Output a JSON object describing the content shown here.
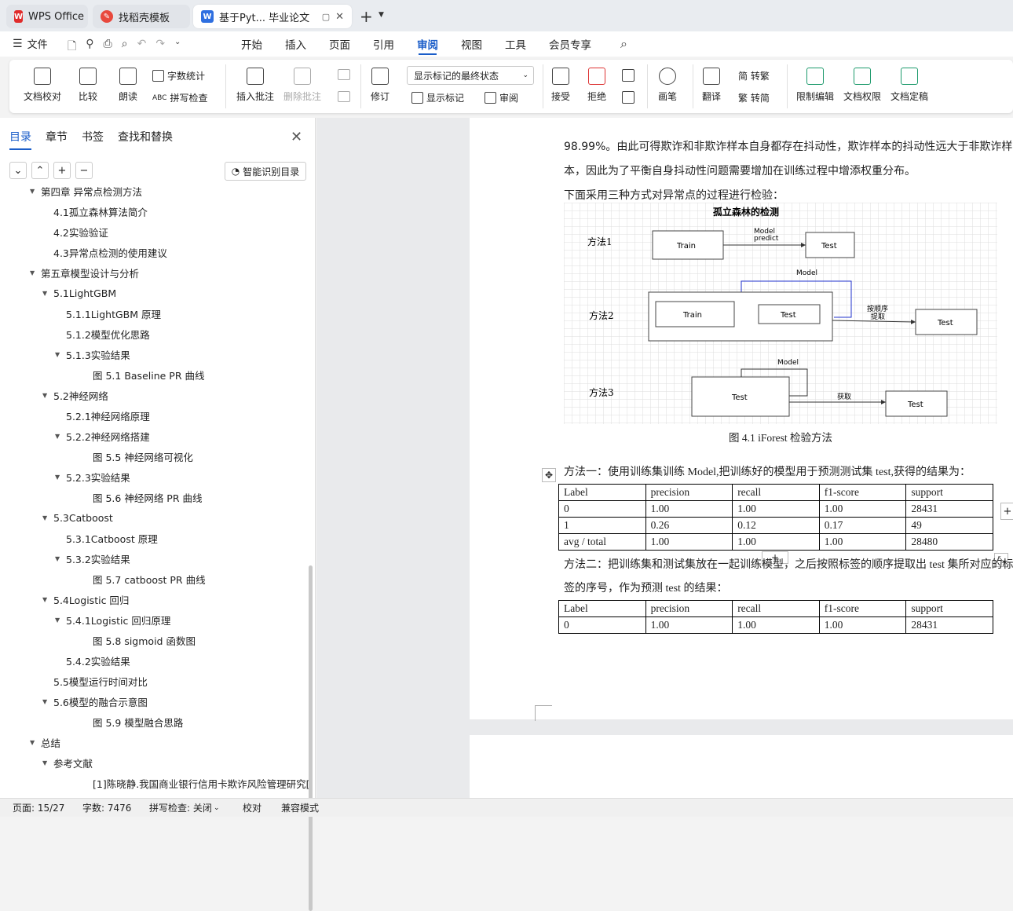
{
  "tabs": [
    {
      "label": "WPS Office",
      "icon": "wps-logo-icon"
    },
    {
      "label": "找稻壳模板",
      "icon": "docer-logo-icon"
    },
    {
      "label": "基于Pyt... 毕业论文",
      "icon": "word-doc-icon"
    }
  ],
  "menu": {
    "file": "文件",
    "items": [
      "开始",
      "插入",
      "页面",
      "引用",
      "审阅",
      "视图",
      "工具",
      "会员专享"
    ],
    "active": "审阅"
  },
  "ribbon": {
    "doc_check": "文档校对",
    "compare": "比较",
    "read_aloud": "朗读",
    "word_count": "字数统计",
    "spell_check": "拼写检查",
    "insert_comment": "插入批注",
    "delete_comment": "删除批注",
    "revise": "修订",
    "markup_state": "显示标记的最终状态",
    "show_markup": "显示标记",
    "review_pane": "审阅",
    "accept": "接受",
    "reject": "拒绝",
    "pen": "画笔",
    "translate": "翻译",
    "to_traditional": "简 转繁",
    "to_simplified": "繁 转简",
    "restrict_edit": "限制编辑",
    "doc_permission": "文档权限",
    "doc_finalize": "文档定稿"
  },
  "left_panel": {
    "tabs": [
      "目录",
      "章节",
      "书签",
      "查找和替换"
    ],
    "smart_btn": "智能识别目录",
    "toc": [
      {
        "label": "第四章 异常点检测方法",
        "level": 1,
        "expand": "down"
      },
      {
        "label": "4.1孤立森林算法简介",
        "level": 2,
        "expand": ""
      },
      {
        "label": "4.2实验验证",
        "level": 2,
        "expand": ""
      },
      {
        "label": "4.3异常点检测的使用建议",
        "level": 2,
        "expand": ""
      },
      {
        "label": "第五章模型设计与分析",
        "level": 1,
        "expand": "down"
      },
      {
        "label": "5.1LightGBM",
        "level": 2,
        "expand": "down"
      },
      {
        "label": "5.1.1LightGBM 原理",
        "level": 3,
        "expand": ""
      },
      {
        "label": "5.1.2模型优化思路",
        "level": 3,
        "expand": ""
      },
      {
        "label": "5.1.3实验结果",
        "level": 3,
        "expand": "down"
      },
      {
        "label": "图 5.1 Baseline PR 曲线",
        "level": 4,
        "expand": ""
      },
      {
        "label": "5.2神经网络",
        "level": 2,
        "expand": "down"
      },
      {
        "label": "5.2.1神经网络原理",
        "level": 3,
        "expand": ""
      },
      {
        "label": "5.2.2神经网络搭建",
        "level": 3,
        "expand": "down"
      },
      {
        "label": "图 5.5 神经网络可视化",
        "level": 4,
        "expand": ""
      },
      {
        "label": "5.2.3实验结果",
        "level": 3,
        "expand": "down"
      },
      {
        "label": "图 5.6  神经网络 PR 曲线",
        "level": 4,
        "expand": ""
      },
      {
        "label": "5.3Catboost",
        "level": 2,
        "expand": "down"
      },
      {
        "label": "5.3.1Catboost 原理",
        "level": 3,
        "expand": ""
      },
      {
        "label": "5.3.2实验结果",
        "level": 3,
        "expand": "down"
      },
      {
        "label": "图 5.7 catboost PR 曲线",
        "level": 4,
        "expand": ""
      },
      {
        "label": "5.4Logistic 回归",
        "level": 2,
        "expand": "down"
      },
      {
        "label": "5.4.1Logistic 回归原理",
        "level": 3,
        "expand": "down"
      },
      {
        "label": "图 5.8  sigmoid 函数图",
        "level": 4,
        "expand": ""
      },
      {
        "label": "5.4.2实验结果",
        "level": 3,
        "expand": ""
      },
      {
        "label": "5.5模型运行时间对比",
        "level": 2,
        "expand": ""
      },
      {
        "label": "5.6模型的融合示意图",
        "level": 2,
        "expand": "down"
      },
      {
        "label": "图 5.9 模型融合思路",
        "level": 4,
        "expand": ""
      },
      {
        "label": "总结",
        "level": 1,
        "expand": "down"
      },
      {
        "label": "参考文献",
        "level": 2,
        "expand": "down"
      },
      {
        "label": "[1]陈晓静.我国商业银行信用卡欺诈风险管理研究[...",
        "level": 4,
        "expand": ""
      }
    ]
  },
  "document": {
    "para1_a": "98.99%。由此可得欺诈和非欺诈样本自身都存在抖动性，欺诈样本的抖动性远大于非欺诈样",
    "para1_b": "本，因此为了平衡自身抖动性问题需要增加在训练过程中增添权重分布。",
    "para2": "下面采用三种方式对异常点的过程进行检验：",
    "figure": {
      "title": "孤立森林的检测",
      "m1": "方法1",
      "m2": "方法2",
      "m3": "方法3",
      "train": "Train",
      "test": "Test",
      "model_predict_1": "Model",
      "model_predict_2": "predict",
      "model": "Model",
      "order_1": "按顺序",
      "order_2": "提取",
      "fetch": "获取"
    },
    "caption": "图 4.1 iForest 检验方法",
    "method1": "方法一：使用训练集训练 Model,把训练好的模型用于预测测试集 test,获得的结果为：",
    "table1": {
      "header": [
        "Label",
        "precision",
        "recall",
        "f1-score",
        "support"
      ],
      "rows": [
        [
          "0",
          "1.00",
          "1.00",
          "1.00",
          "28431"
        ],
        [
          "1",
          "0.26",
          "0.12",
          "0.17",
          "49"
        ],
        [
          "avg / total",
          "1.00",
          "1.00",
          "1.00",
          "28480"
        ]
      ]
    },
    "method2_a": "方法二：把训练集和测试集放在一起训练模型，之后按照标签的顺序提取出 test 集所对应的标",
    "method2_b": "签的序号，作为预测 test 的结果：",
    "table2": {
      "header": [
        "Label",
        "precision",
        "recall",
        "f1-score",
        "support"
      ],
      "rows": [
        [
          "0",
          "1.00",
          "1.00",
          "1.00",
          "28431"
        ]
      ]
    }
  },
  "status": {
    "page": "页面: 15/27",
    "words": "字数: 7476",
    "spell": "拼写检查: 关闭",
    "proof": "校对",
    "compat": "兼容模式"
  }
}
